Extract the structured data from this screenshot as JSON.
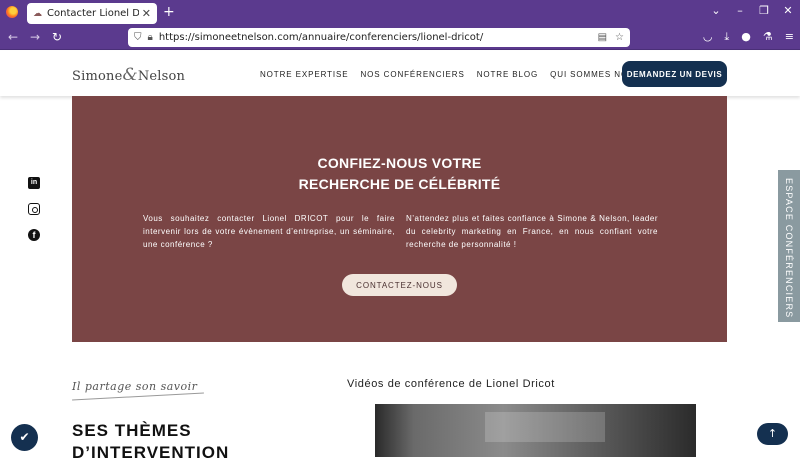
{
  "browser": {
    "tab_title": "Contacter Lionel DRICOT",
    "url": "https://simoneetnelson.com/annuaire/conferenciers/lionel-dricot/"
  },
  "header": {
    "logo_text": "Simone",
    "logo_amp": "&",
    "logo_text2": "Nelson",
    "menu": [
      "NOTRE EXPERTISE",
      "NOS CONFÉRENCIERS",
      "NOTRE BLOG",
      "QUI SOMMES NOUS ?"
    ],
    "cta": "DEMANDEZ UN DEVIS"
  },
  "hero": {
    "title_line1": "CONFIEZ-NOUS VOTRE",
    "title_line2": "RECHERCHE DE CÉLÉBRITÉ",
    "left_text": "Vous souhaitez contacter Lionel DRICOT pour le faire intervenir lors de votre évènement d’entreprise, un séminaire, une conférence ?",
    "right_text": "N’attendez plus et faites confiance à Simone & Nelson, leader du celebrity marketing en France, en nous confiant votre recherche de personnalité !",
    "button": "CONTACTEZ-NOUS",
    "bg_color": "#7a4545"
  },
  "side_tab": "ESPACE CONFÉRENCIERS",
  "section": {
    "script": "Il partage son savoir",
    "themes_line1": "SES THÈMES",
    "themes_line2": "D’INTERVENTION",
    "videos_title": "Vidéos de conférence de Lionel Dricot"
  },
  "icons": {
    "social": [
      "linkedin-icon",
      "instagram-icon",
      "facebook-icon"
    ]
  },
  "colors": {
    "browser": "#5b3a8e",
    "navy": "#143050"
  }
}
